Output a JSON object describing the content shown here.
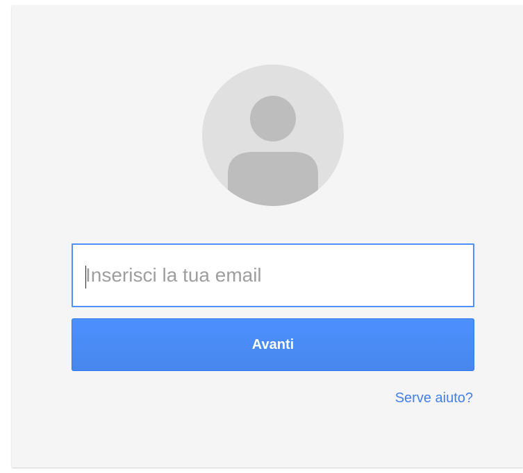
{
  "login": {
    "avatar_icon": "default-user-icon",
    "email_placeholder": "Inserisci la tua email",
    "email_value": "",
    "next_label": "Avanti",
    "help_label": "Serve aiuto?"
  },
  "colors": {
    "card_background": "#f5f5f5",
    "accent_blue": "#4787ed",
    "input_focus_border": "#4d90fe",
    "link_blue": "#427fed",
    "avatar_background": "#e0e0e0",
    "avatar_figure": "#bdbdbd"
  }
}
